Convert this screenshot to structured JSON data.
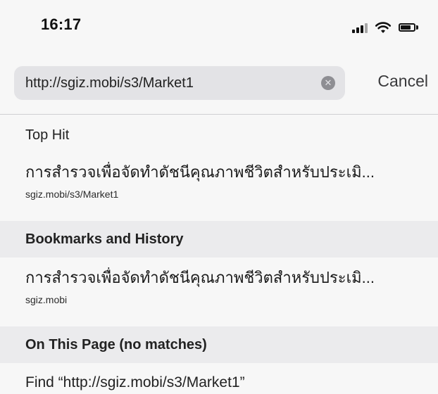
{
  "status_bar": {
    "time": "16:17",
    "icons": [
      "signal-icon",
      "wifi-icon",
      "battery-icon"
    ]
  },
  "search": {
    "url_value": "http://sgiz.mobi/s3/Market1",
    "cancel_label": "Cancel",
    "clear_icon": "clear-icon"
  },
  "sections": {
    "top_hit": {
      "header": "Top Hit",
      "title": "การสำรวจเพื่อจัดทำดัชนีคุณภาพชีวิตสำหรับประเมิ...",
      "url": "sgiz.mobi/s3/Market1"
    },
    "bookmarks_history": {
      "header": "Bookmarks and History",
      "title": "การสำรวจเพื่อจัดทำดัชนีคุณภาพชีวิตสำหรับประเมิ...",
      "url": "sgiz.mobi"
    },
    "on_this_page": {
      "header": "On This Page (no matches)",
      "find_label": "Find “http://sgiz.mobi/s3/Market1”"
    }
  },
  "colors": {
    "background": "#f7f7f7",
    "field": "#e3e3e6",
    "section_header_bg": "#ebebed",
    "text": "#1c1c1e"
  }
}
